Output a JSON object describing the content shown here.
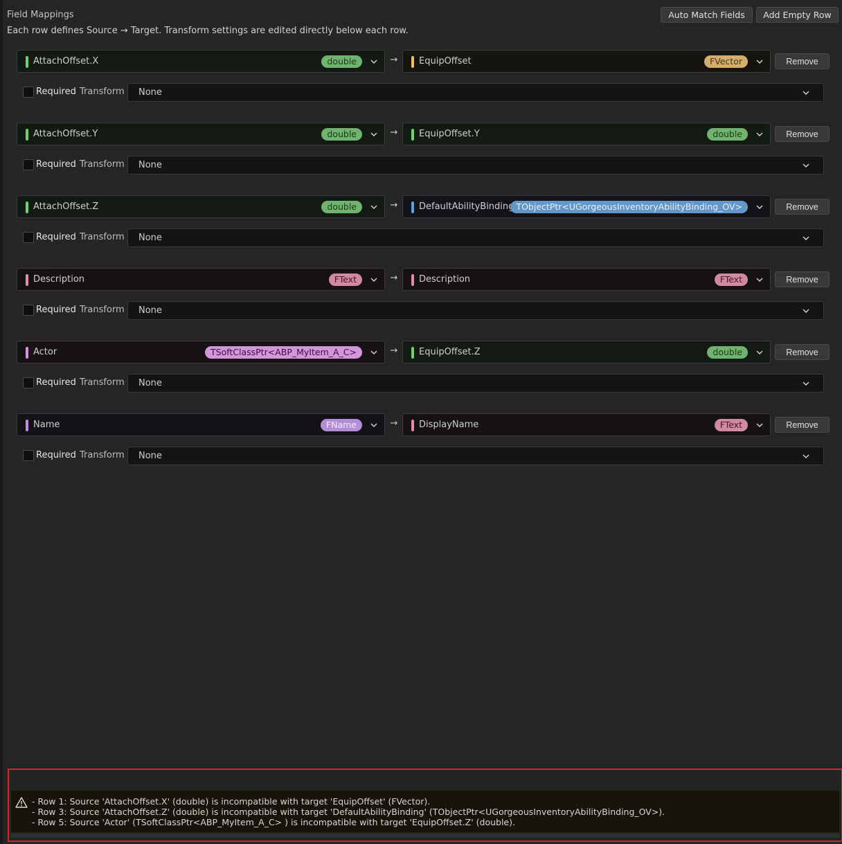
{
  "header": {
    "title": "Field Mappings",
    "description": "Each row defines Source → Target. Transform settings are edited directly below each row.",
    "auto_match_label": "Auto Match Fields",
    "add_row_label": "Add Empty Row"
  },
  "row_common": {
    "arrow": "→",
    "remove_label": "Remove",
    "required_label": "Required",
    "transform_label": "Transform"
  },
  "rows": [
    {
      "source": {
        "name": "AttachOffset.X",
        "type": "double",
        "color": "#6bd36b",
        "pill_bg": "#6fb36f",
        "pill_fg": "#1d3a1d",
        "tint": "#131a13"
      },
      "target": {
        "name": "EquipOffset",
        "type": "FVector",
        "color": "#f0c060",
        "pill_bg": "#d4ae6c",
        "pill_fg": "#4a3410",
        "tint": "#15140f"
      },
      "required": false,
      "transform": "None"
    },
    {
      "source": {
        "name": "AttachOffset.Y",
        "type": "double",
        "color": "#6bd36b",
        "pill_bg": "#6fb36f",
        "pill_fg": "#1d3a1d",
        "tint": "#131a13"
      },
      "target": {
        "name": "EquipOffset.Y",
        "type": "double",
        "color": "#6bd36b",
        "pill_bg": "#6fb36f",
        "pill_fg": "#1d3a1d",
        "tint": "#131a13"
      },
      "required": false,
      "transform": "None"
    },
    {
      "source": {
        "name": "AttachOffset.Z",
        "type": "double",
        "color": "#6bd36b",
        "pill_bg": "#6fb36f",
        "pill_fg": "#1d3a1d",
        "tint": "#131a13"
      },
      "target": {
        "name": "DefaultAbilityBinding",
        "type": "TObjectPtr<UGorgeousInventoryAbilityBinding_OV>",
        "color": "#5aa0e8",
        "pill_bg": "#6396c9",
        "pill_fg": "#e8f0fa",
        "tint": "#121418"
      },
      "required": false,
      "transform": "None"
    },
    {
      "source": {
        "name": "Description",
        "type": "FText",
        "color": "#e58aa8",
        "pill_bg": "#d08aa0",
        "pill_fg": "#4a1626",
        "tint": "#161213"
      },
      "target": {
        "name": "Description",
        "type": "FText",
        "color": "#e58aa8",
        "pill_bg": "#d08aa0",
        "pill_fg": "#4a1626",
        "tint": "#161213"
      },
      "required": false,
      "transform": "None"
    },
    {
      "source": {
        "name": "Actor",
        "type": "TSoftClassPtr<ABP_MyItem_A_C>",
        "color": "#e08ae6",
        "pill_bg": "#d396d8",
        "pill_fg": "#3a1040",
        "tint": "#161216"
      },
      "target": {
        "name": "EquipOffset.Z",
        "type": "double",
        "color": "#6bd36b",
        "pill_bg": "#6fb36f",
        "pill_fg": "#1d3a1d",
        "tint": "#131a13"
      },
      "required": false,
      "transform": "None"
    },
    {
      "source": {
        "name": "Name",
        "type": "FName",
        "color": "#c08ae6",
        "pill_bg": "#b38ed8",
        "pill_fg": "#f2e8fa",
        "tint": "#141216"
      },
      "target": {
        "name": "DisplayName",
        "type": "FText",
        "color": "#e58aa8",
        "pill_bg": "#d08aa0",
        "pill_fg": "#4a1626",
        "tint": "#161213"
      },
      "required": false,
      "transform": "None"
    }
  ],
  "errors": {
    "icon": "warning-triangle-icon",
    "lines": [
      "- Row 1: Source 'AttachOffset.X' (double) is incompatible with target 'EquipOffset' (FVector).",
      "- Row 3: Source 'AttachOffset.Z' (double) is incompatible with target 'DefaultAbilityBinding' (TObjectPtr<UGorgeousInventoryAbilityBinding_OV>).",
      "- Row 5: Source 'Actor' (TSoftClassPtr<ABP_MyItem_A_C> ) is incompatible with target 'EquipOffset.Z' (double)."
    ],
    "border_color": "#e02020"
  }
}
